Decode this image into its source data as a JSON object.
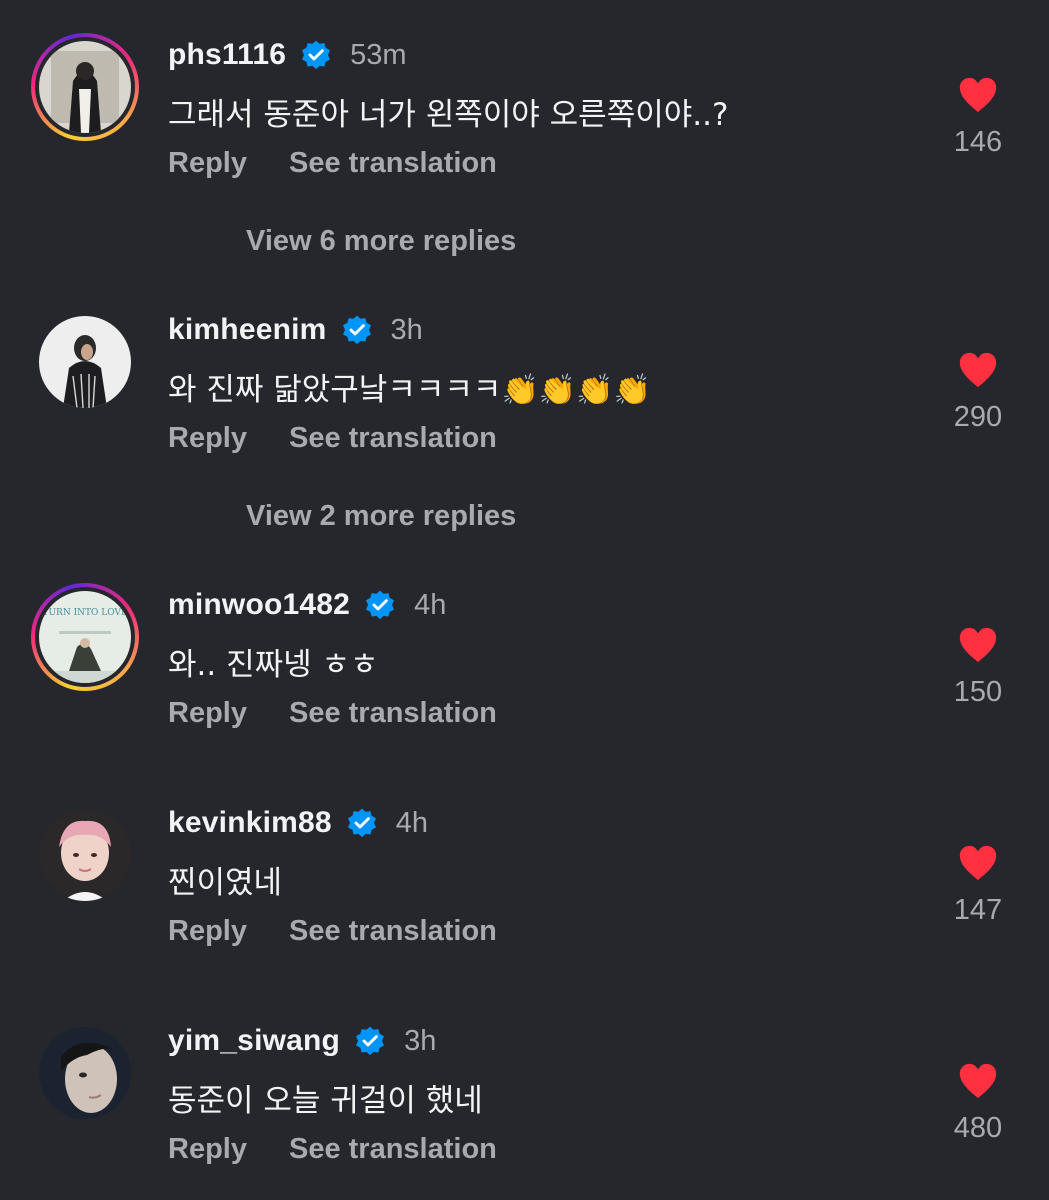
{
  "colors": {
    "background": "#25272c",
    "heart": "#ff3040",
    "verified": "#0095f6",
    "secondary_text": "#a7aab0"
  },
  "actions": {
    "reply_label": "Reply",
    "translate_label": "See translation"
  },
  "comments": [
    {
      "username": "phs1116",
      "verified": true,
      "time": "53m",
      "text": "그래서 동준아 너가 왼쪽이야 오른쪽이야..?",
      "likes": "146",
      "view_replies": "View 6 more replies",
      "has_story_ring": true
    },
    {
      "username": "kimheenim",
      "verified": true,
      "time": "3h",
      "text": "와 진짜 닮았구낰ㅋㅋㅋㅋ",
      "emoji": "👏👏👏👏",
      "likes": "290",
      "view_replies": "View 2 more replies",
      "has_story_ring": false
    },
    {
      "username": "minwoo1482",
      "verified": true,
      "time": "4h",
      "text": "와.. 진짜넹 ㅎㅎ",
      "likes": "150",
      "has_story_ring": true,
      "avatar_caption": "TURN INTO LOVE"
    },
    {
      "username": "kevinkim88",
      "verified": true,
      "time": "4h",
      "text": "찐이였네",
      "likes": "147",
      "has_story_ring": false
    },
    {
      "username": "yim_siwang",
      "verified": true,
      "time": "3h",
      "text": "동준이 오늘 귀걸이 했네",
      "likes": "480",
      "has_story_ring": false
    }
  ]
}
